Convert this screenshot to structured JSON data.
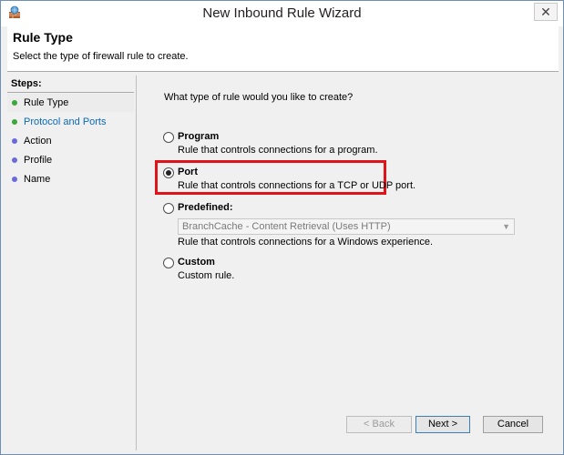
{
  "window": {
    "title": "New Inbound Rule Wizard",
    "close_glyph": "✕"
  },
  "header": {
    "title": "Rule Type",
    "description": "Select the type of firewall rule to create."
  },
  "steps": {
    "label": "Steps:",
    "items": [
      {
        "label": "Rule Type",
        "status": "current"
      },
      {
        "label": "Protocol and Ports",
        "status": "link"
      },
      {
        "label": "Action",
        "status": "pending"
      },
      {
        "label": "Profile",
        "status": "pending"
      },
      {
        "label": "Name",
        "status": "pending"
      }
    ]
  },
  "content": {
    "question": "What type of rule would you like to create?",
    "options": [
      {
        "title": "Program",
        "description": "Rule that controls connections for a program.",
        "checked": false
      },
      {
        "title": "Port",
        "description": "Rule that controls connections for a TCP or UDP port.",
        "checked": true
      },
      {
        "title": "Predefined:",
        "description": "Rule that controls connections for a Windows experience.",
        "checked": false
      },
      {
        "title": "Custom",
        "description": "Custom rule.",
        "checked": false
      }
    ],
    "predefined_select": {
      "value": "BranchCache - Content Retrieval (Uses HTTP)",
      "enabled": false
    }
  },
  "buttons": {
    "back": "< Back",
    "next": "Next >",
    "cancel": "Cancel"
  },
  "colors": {
    "highlight": "#e0121a",
    "step_done": "#3aa83a",
    "step_pending": "#6a6adf",
    "link": "#0a6ab8"
  }
}
